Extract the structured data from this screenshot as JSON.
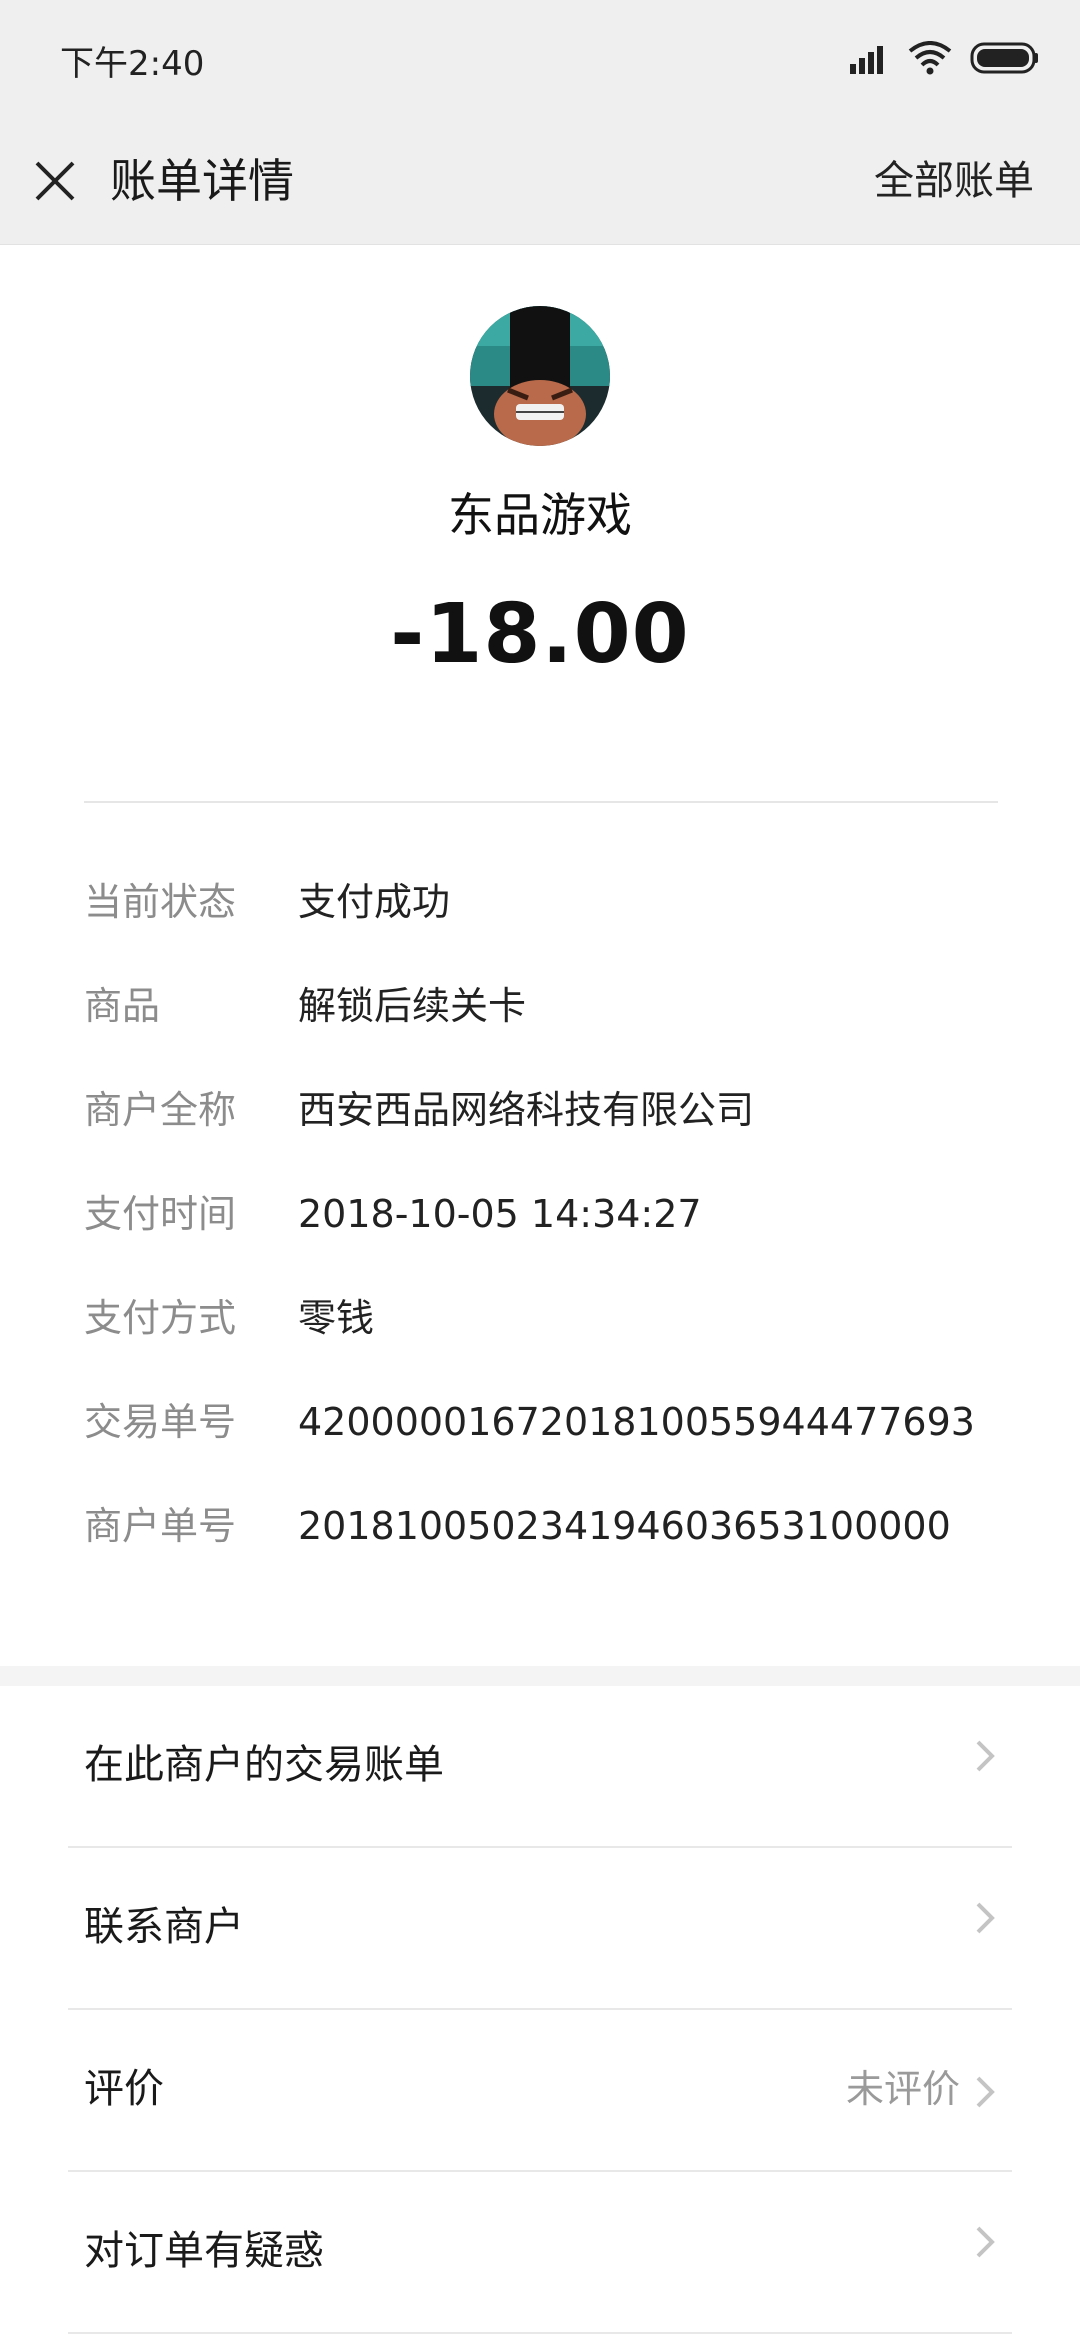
{
  "status_bar": {
    "time": "下午2:40"
  },
  "nav": {
    "title": "账单详情",
    "right_action": "全部账单"
  },
  "merchant": {
    "name": "东品游戏",
    "amount": "-18.00"
  },
  "details": [
    {
      "label": "当前状态",
      "value": "支付成功"
    },
    {
      "label": "商品",
      "value": "解锁后续关卡"
    },
    {
      "label": "商户全称",
      "value": "西安西品网络科技有限公司"
    },
    {
      "label": "支付时间",
      "value": "2018-10-05 14:34:27"
    },
    {
      "label": "支付方式",
      "value": "零钱"
    },
    {
      "label": "交易单号",
      "value": "4200000167201810055944477693"
    },
    {
      "label": "商户单号",
      "value": "201810050234194603653100000"
    }
  ],
  "menu": [
    {
      "label": "在此商户的交易账单",
      "right": ""
    },
    {
      "label": "联系商户",
      "right": ""
    },
    {
      "label": "评价",
      "right": "未评价"
    },
    {
      "label": "对订单有疑惑",
      "right": ""
    }
  ],
  "icons": {
    "close": "close-icon",
    "chevron": "chevron-right-icon",
    "signal": "signal-icon",
    "wifi": "wifi-icon",
    "battery": "battery-icon"
  },
  "colors": {
    "nav_bg": "#efefef",
    "label_gray": "#8c8c8c",
    "text_dark": "#1a1a1a"
  }
}
